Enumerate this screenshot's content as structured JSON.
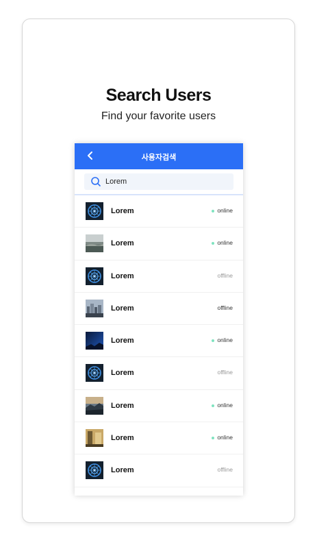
{
  "headline": "Search Users",
  "subline": "Find your favorite users",
  "colors": {
    "accent": "#2b6ff6",
    "online_dot": "#7fe3c0"
  },
  "topbar": {
    "title": "사용자검색",
    "back_icon": "chevron-left-icon"
  },
  "search": {
    "value": "Lorem",
    "icon": "search-icon"
  },
  "users": [
    {
      "name": "Lorem",
      "status": "online",
      "avatar": "ferris-wheel"
    },
    {
      "name": "Lorem",
      "status": "online",
      "avatar": "coast"
    },
    {
      "name": "Lorem",
      "status": "offline",
      "avatar": "ferris-wheel"
    },
    {
      "name": "Lorem",
      "status": "offline",
      "avatar": "city"
    },
    {
      "name": "Lorem",
      "status": "online",
      "avatar": "night-sky"
    },
    {
      "name": "Lorem",
      "status": "offline",
      "avatar": "ferris-wheel"
    },
    {
      "name": "Lorem",
      "status": "online",
      "avatar": "sunset-landscape"
    },
    {
      "name": "Lorem",
      "status": "online",
      "avatar": "golden-interior"
    },
    {
      "name": "Lorem",
      "status": "offline",
      "avatar": "ferris-wheel"
    }
  ]
}
